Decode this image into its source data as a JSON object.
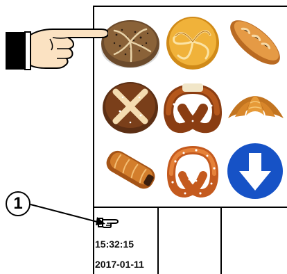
{
  "products": [
    {
      "name": "poppy-seed-roll"
    },
    {
      "name": "kaiser-roll"
    },
    {
      "name": "baguette-roll"
    },
    {
      "name": "pretzel-roll"
    },
    {
      "name": "butter-pretzel"
    },
    {
      "name": "croissant"
    },
    {
      "name": "chocolate-croissant"
    },
    {
      "name": "sugar-pretzel"
    },
    {
      "name": "scroll-down"
    }
  ],
  "status": {
    "time": "15:32:15",
    "date": "2017-01-11",
    "indicator_icon": "pointing-hand-icon"
  },
  "annotation": {
    "callout_number": "1",
    "pointer_icon": "pointing-hand-icon"
  },
  "colors": {
    "scroll_button": "#1652c6",
    "panel_border": "#000000"
  }
}
